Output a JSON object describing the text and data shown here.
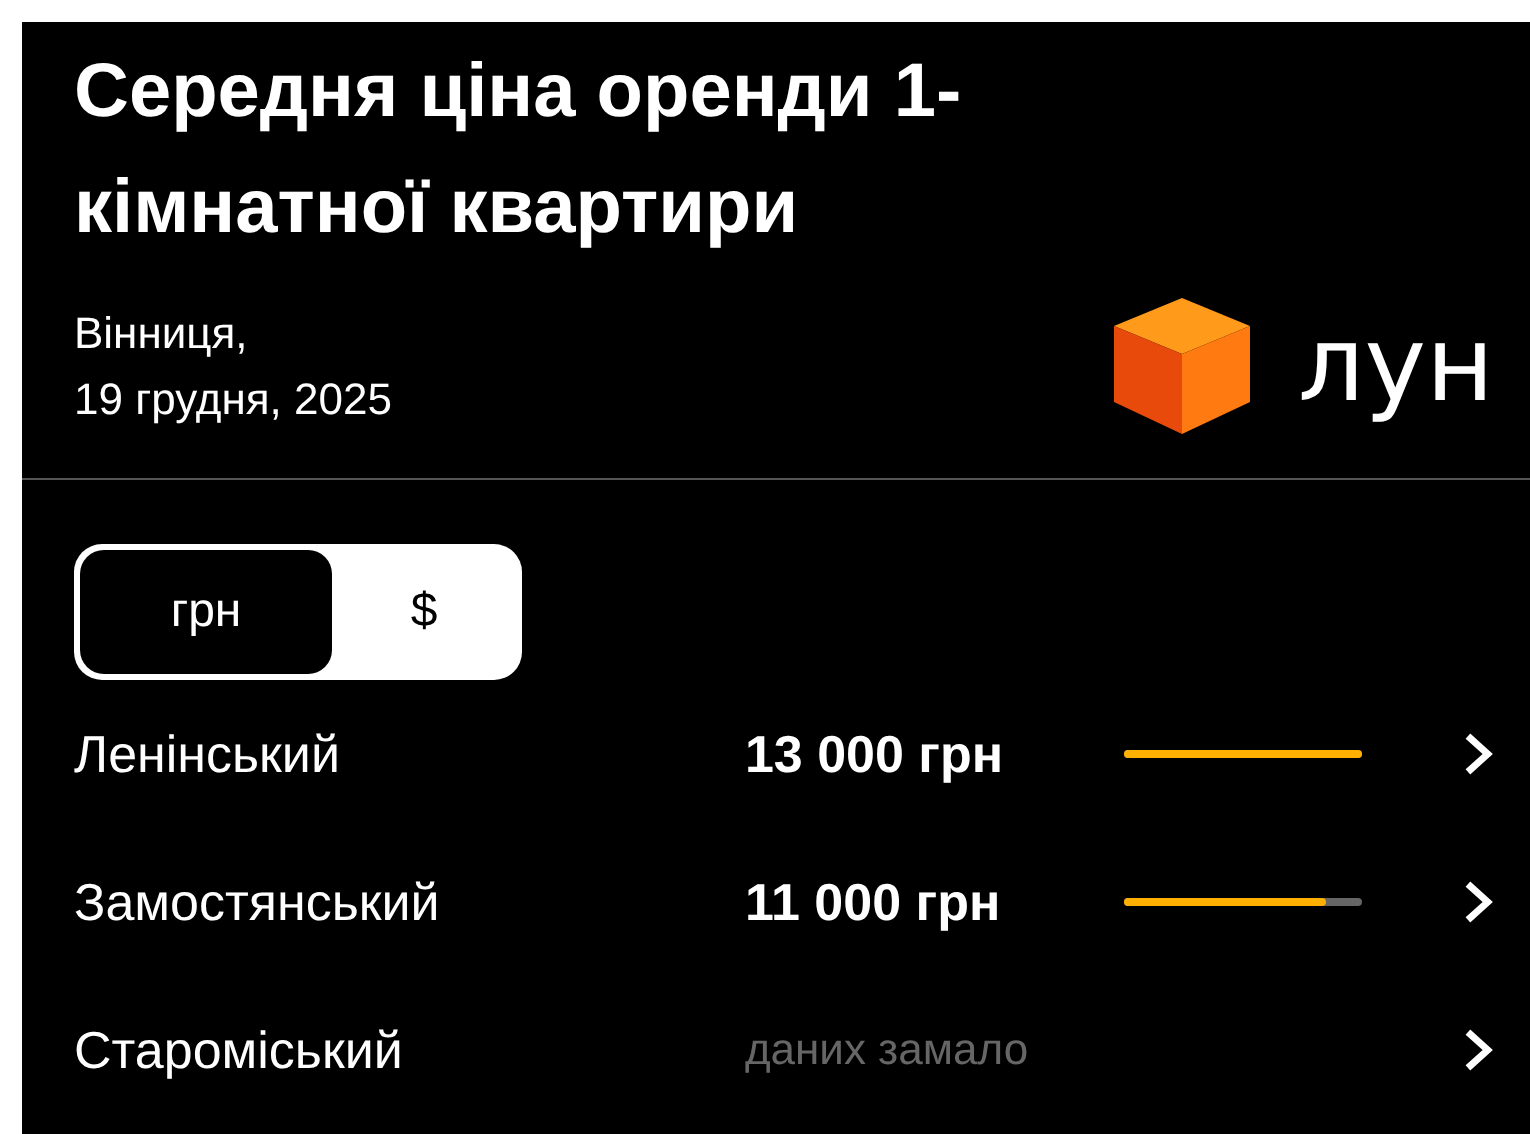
{
  "title": "Середня ціна оренди 1-кімнатної квартири",
  "subtitle": [
    "Вінниця,",
    "19 грудня, 2025"
  ],
  "logo": {
    "text": "лун"
  },
  "currency_toggle": [
    {
      "label": "грн",
      "selected": true
    },
    {
      "label": "$",
      "selected": false
    }
  ],
  "districts": [
    {
      "name": "Ленінський",
      "kind": "price",
      "price": "13 000 грн",
      "level": 1.0
    },
    {
      "name": "Замостянський",
      "kind": "price",
      "price": "11 000 грн",
      "level": 0.85
    },
    {
      "name": "Староміський",
      "kind": "nodata",
      "note": "даних замало"
    }
  ]
}
